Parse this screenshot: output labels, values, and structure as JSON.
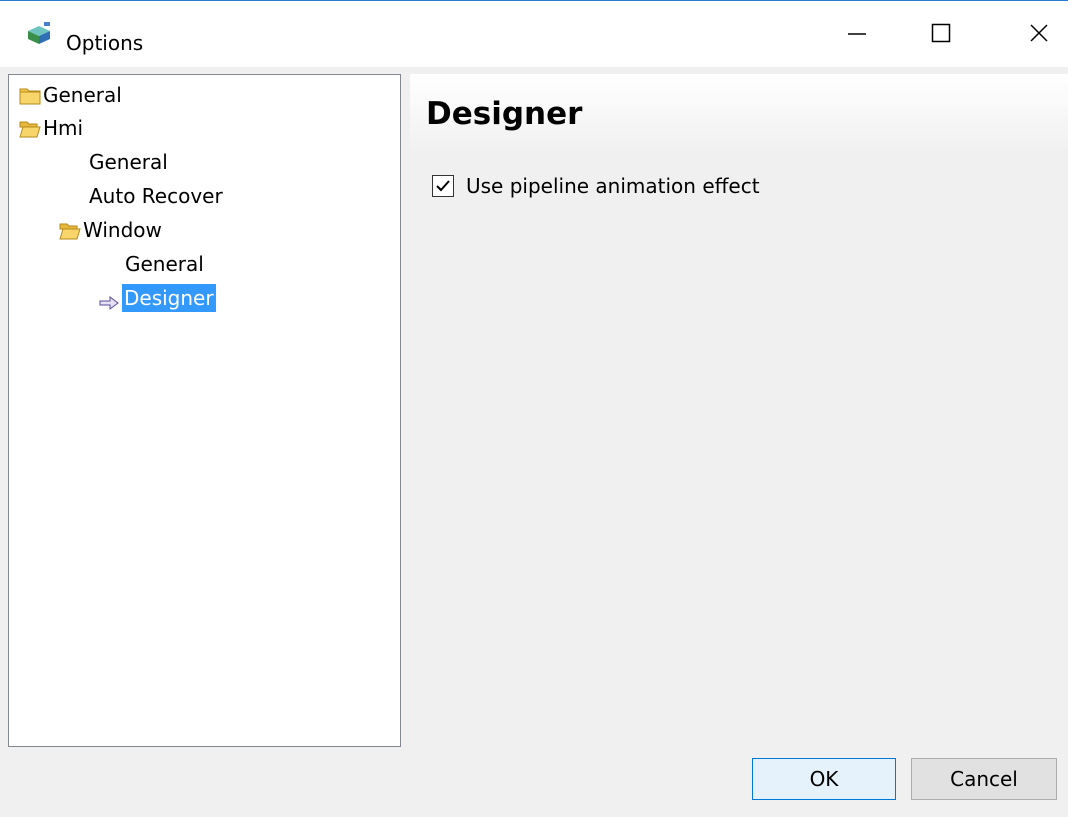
{
  "window": {
    "title": "Options",
    "app_icon": "options-app-icon",
    "controls": {
      "minimize_icon": "minimize-icon",
      "maximize_icon": "maximize-icon",
      "close_icon": "close-icon"
    },
    "accent_color": "#2b79d0"
  },
  "tree": {
    "items": [
      {
        "label": "General",
        "icon": "folder-closed-icon",
        "level": 0
      },
      {
        "label": "Hmi",
        "icon": "folder-open-icon",
        "level": 0
      },
      {
        "label": "General",
        "icon": "",
        "level": 1
      },
      {
        "label": "Auto Recover",
        "icon": "",
        "level": 1
      },
      {
        "label": "Window",
        "icon": "folder-open-icon",
        "level": 1
      },
      {
        "label": "General",
        "icon": "",
        "level": 2
      },
      {
        "label": "Designer",
        "icon": "arrow-right-icon",
        "level": 2,
        "selected": true
      }
    ],
    "selection_color": "#3399ff"
  },
  "content": {
    "title": "Designer",
    "options": [
      {
        "label": "Use pipeline animation effect",
        "checked": true
      }
    ]
  },
  "buttons": {
    "ok_label": "OK",
    "cancel_label": "Cancel"
  }
}
